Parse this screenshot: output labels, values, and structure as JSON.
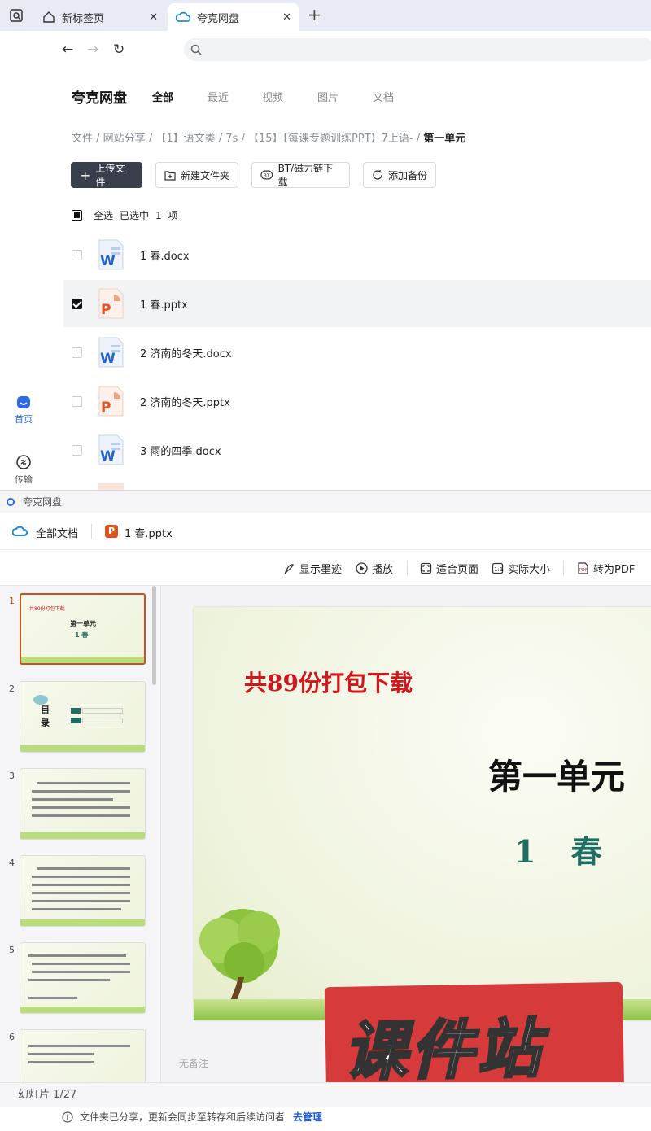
{
  "browser": {
    "tabs": [
      {
        "label": "新标签页"
      },
      {
        "label": "夸克网盘"
      }
    ]
  },
  "sidebar": {
    "items": [
      {
        "label": "首页"
      },
      {
        "label": "传输"
      }
    ]
  },
  "header": {
    "brand": "夸克网盘",
    "filter_tabs": [
      "全部",
      "最近",
      "视频",
      "图片",
      "文档"
    ]
  },
  "breadcrumb": {
    "items": [
      "文件",
      "网站分享",
      "【1】语文类",
      "7s",
      "【15】【每课专题训练PPT】7上语-",
      "第一单元"
    ]
  },
  "toolbar": {
    "upload": "上传文件",
    "new_folder": "新建文件夹",
    "bt": "BT/磁力链下载",
    "backup": "添加备份"
  },
  "selection": {
    "select_all": "全选",
    "selected_text": "已选中",
    "count": "1",
    "unit": "项"
  },
  "files": [
    {
      "name": "1   春.docx",
      "type": "docx",
      "checked": false
    },
    {
      "name": "1   春.pptx",
      "type": "pptx",
      "checked": true
    },
    {
      "name": "2   济南的冬天.docx",
      "type": "docx",
      "checked": false
    },
    {
      "name": "2   济南的冬天.pptx",
      "type": "pptx",
      "checked": false
    },
    {
      "name": "3   雨的四季.docx",
      "type": "docx",
      "checked": false
    }
  ],
  "viewer": {
    "window_title": "夸克网盘",
    "all_docs": "全部文档",
    "doc_name": "1   春.pptx",
    "tools": [
      "显示墨迹",
      "播放",
      "适合页面",
      "实际大小",
      "转为PDF"
    ],
    "thumb_numbers": [
      "1",
      "2",
      "3",
      "4",
      "5",
      "6"
    ],
    "slide": {
      "top_text": "共89份打包下载",
      "heading": "第一单元",
      "subheading": "1  春"
    },
    "thumb1": {
      "top": "共89份打包下载",
      "h": "第一单元",
      "s": "1   春"
    },
    "thumb2": {
      "a": "目",
      "b": "录"
    },
    "note": "无备注",
    "status": "幻灯片 1/27",
    "watermark": "课件站"
  },
  "notice": {
    "text": "文件夹已分享，更新会同步至转存和后续访问者",
    "link": "去管理"
  }
}
